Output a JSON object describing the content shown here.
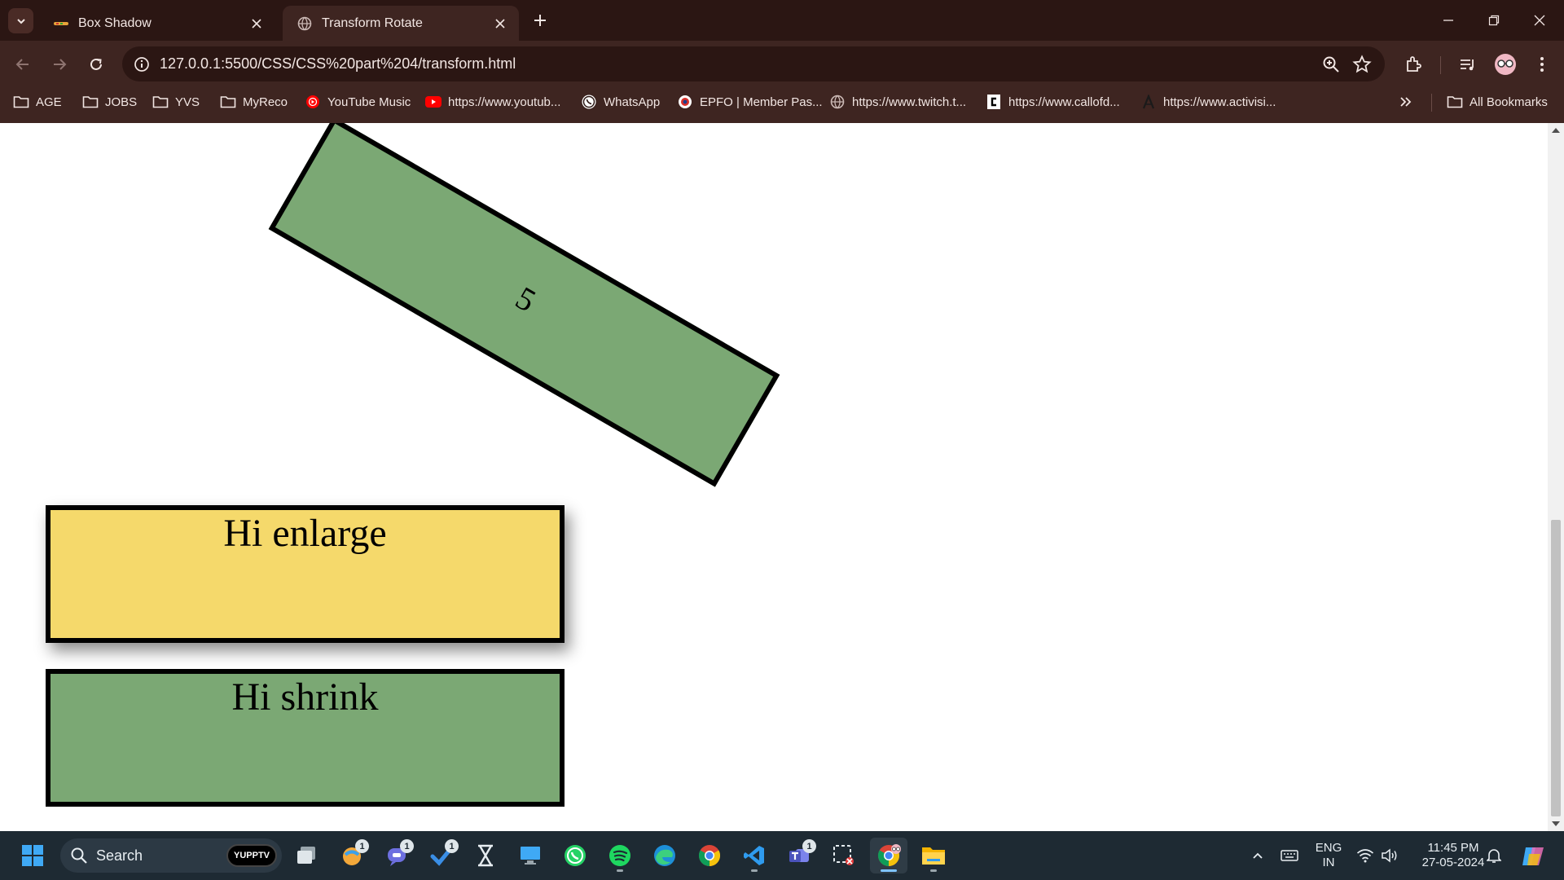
{
  "browser": {
    "tabs": [
      {
        "title": "Box Shadow",
        "active": false,
        "favicon": "colored-favicon"
      },
      {
        "title": "Transform Rotate",
        "active": true,
        "favicon": "globe-icon"
      }
    ],
    "url": "127.0.0.1:5500/CSS/CSS%20part%204/transform.html",
    "bookmarks": [
      {
        "label": "AGE",
        "icon": "folder-icon"
      },
      {
        "label": "JOBS",
        "icon": "folder-icon"
      },
      {
        "label": "YVS",
        "icon": "folder-icon"
      },
      {
        "label": "MyReco",
        "icon": "folder-icon"
      },
      {
        "label": "YouTube Music",
        "icon": "youtube-music-icon"
      },
      {
        "label": "https://www.youtub...",
        "icon": "youtube-icon"
      },
      {
        "label": "WhatsApp",
        "icon": "whatsapp-icon"
      },
      {
        "label": "EPFO | Member Pas...",
        "icon": "epfo-icon"
      },
      {
        "label": "https://www.twitch.t...",
        "icon": "globe-icon"
      },
      {
        "label": "https://www.callofd...",
        "icon": "callofduty-icon"
      },
      {
        "label": "https://www.activisi...",
        "icon": "activision-icon"
      }
    ],
    "all_bookmarks": "All Bookmarks"
  },
  "page": {
    "rotated_box_text": "5",
    "enlarge_box_text": "Hi enlarge",
    "shrink_box_text": "Hi shrink",
    "colors": {
      "green_box": "#7ba874",
      "yellow_box": "#f5d96b",
      "border": "#000000"
    }
  },
  "taskbar": {
    "search_label": "Search",
    "search_badge": "YUPPTV",
    "apps": [
      {
        "name": "task-view",
        "badge": ""
      },
      {
        "name": "ornament",
        "badge": "1"
      },
      {
        "name": "chat",
        "badge": "1"
      },
      {
        "name": "todo",
        "badge": "1"
      },
      {
        "name": "hourglass",
        "badge": ""
      },
      {
        "name": "remote-desktop",
        "badge": ""
      },
      {
        "name": "whatsapp",
        "badge": ""
      },
      {
        "name": "spotify",
        "badge": ""
      },
      {
        "name": "edge",
        "badge": ""
      },
      {
        "name": "chrome",
        "badge": ""
      },
      {
        "name": "vscode",
        "badge": ""
      },
      {
        "name": "teams",
        "badge": "1"
      },
      {
        "name": "snipping-tool",
        "badge": ""
      },
      {
        "name": "chrome-profile",
        "badge": ""
      },
      {
        "name": "file-explorer",
        "badge": ""
      }
    ],
    "lang_top": "ENG",
    "lang_bottom": "IN",
    "time": "11:45 PM",
    "date": "27-05-2024"
  }
}
